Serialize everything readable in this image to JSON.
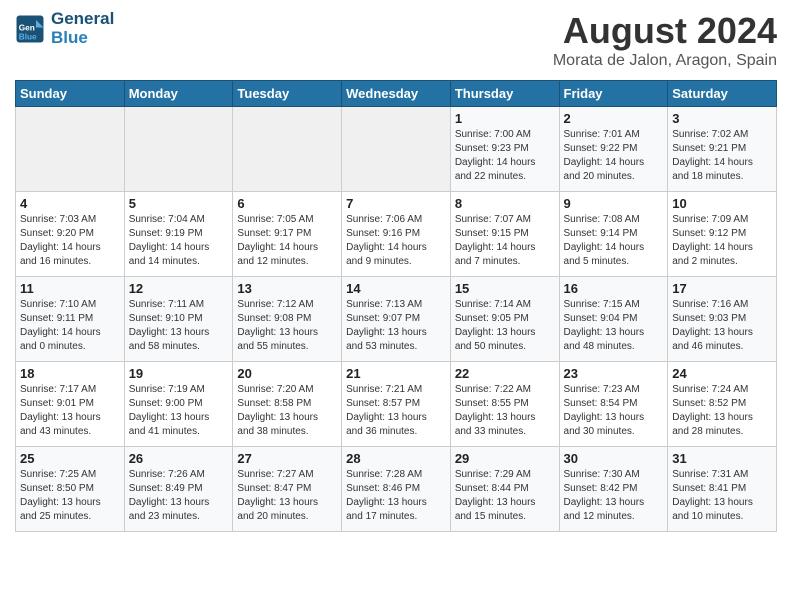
{
  "logo": {
    "line1": "General",
    "line2": "Blue"
  },
  "title": "August 2024",
  "subtitle": "Morata de Jalon, Aragon, Spain",
  "weekdays": [
    "Sunday",
    "Monday",
    "Tuesday",
    "Wednesday",
    "Thursday",
    "Friday",
    "Saturday"
  ],
  "weeks": [
    [
      {
        "day": "",
        "info": ""
      },
      {
        "day": "",
        "info": ""
      },
      {
        "day": "",
        "info": ""
      },
      {
        "day": "",
        "info": ""
      },
      {
        "day": "1",
        "info": "Sunrise: 7:00 AM\nSunset: 9:23 PM\nDaylight: 14 hours\nand 22 minutes."
      },
      {
        "day": "2",
        "info": "Sunrise: 7:01 AM\nSunset: 9:22 PM\nDaylight: 14 hours\nand 20 minutes."
      },
      {
        "day": "3",
        "info": "Sunrise: 7:02 AM\nSunset: 9:21 PM\nDaylight: 14 hours\nand 18 minutes."
      }
    ],
    [
      {
        "day": "4",
        "info": "Sunrise: 7:03 AM\nSunset: 9:20 PM\nDaylight: 14 hours\nand 16 minutes."
      },
      {
        "day": "5",
        "info": "Sunrise: 7:04 AM\nSunset: 9:19 PM\nDaylight: 14 hours\nand 14 minutes."
      },
      {
        "day": "6",
        "info": "Sunrise: 7:05 AM\nSunset: 9:17 PM\nDaylight: 14 hours\nand 12 minutes."
      },
      {
        "day": "7",
        "info": "Sunrise: 7:06 AM\nSunset: 9:16 PM\nDaylight: 14 hours\nand 9 minutes."
      },
      {
        "day": "8",
        "info": "Sunrise: 7:07 AM\nSunset: 9:15 PM\nDaylight: 14 hours\nand 7 minutes."
      },
      {
        "day": "9",
        "info": "Sunrise: 7:08 AM\nSunset: 9:14 PM\nDaylight: 14 hours\nand 5 minutes."
      },
      {
        "day": "10",
        "info": "Sunrise: 7:09 AM\nSunset: 9:12 PM\nDaylight: 14 hours\nand 2 minutes."
      }
    ],
    [
      {
        "day": "11",
        "info": "Sunrise: 7:10 AM\nSunset: 9:11 PM\nDaylight: 14 hours\nand 0 minutes."
      },
      {
        "day": "12",
        "info": "Sunrise: 7:11 AM\nSunset: 9:10 PM\nDaylight: 13 hours\nand 58 minutes."
      },
      {
        "day": "13",
        "info": "Sunrise: 7:12 AM\nSunset: 9:08 PM\nDaylight: 13 hours\nand 55 minutes."
      },
      {
        "day": "14",
        "info": "Sunrise: 7:13 AM\nSunset: 9:07 PM\nDaylight: 13 hours\nand 53 minutes."
      },
      {
        "day": "15",
        "info": "Sunrise: 7:14 AM\nSunset: 9:05 PM\nDaylight: 13 hours\nand 50 minutes."
      },
      {
        "day": "16",
        "info": "Sunrise: 7:15 AM\nSunset: 9:04 PM\nDaylight: 13 hours\nand 48 minutes."
      },
      {
        "day": "17",
        "info": "Sunrise: 7:16 AM\nSunset: 9:03 PM\nDaylight: 13 hours\nand 46 minutes."
      }
    ],
    [
      {
        "day": "18",
        "info": "Sunrise: 7:17 AM\nSunset: 9:01 PM\nDaylight: 13 hours\nand 43 minutes."
      },
      {
        "day": "19",
        "info": "Sunrise: 7:19 AM\nSunset: 9:00 PM\nDaylight: 13 hours\nand 41 minutes."
      },
      {
        "day": "20",
        "info": "Sunrise: 7:20 AM\nSunset: 8:58 PM\nDaylight: 13 hours\nand 38 minutes."
      },
      {
        "day": "21",
        "info": "Sunrise: 7:21 AM\nSunset: 8:57 PM\nDaylight: 13 hours\nand 36 minutes."
      },
      {
        "day": "22",
        "info": "Sunrise: 7:22 AM\nSunset: 8:55 PM\nDaylight: 13 hours\nand 33 minutes."
      },
      {
        "day": "23",
        "info": "Sunrise: 7:23 AM\nSunset: 8:54 PM\nDaylight: 13 hours\nand 30 minutes."
      },
      {
        "day": "24",
        "info": "Sunrise: 7:24 AM\nSunset: 8:52 PM\nDaylight: 13 hours\nand 28 minutes."
      }
    ],
    [
      {
        "day": "25",
        "info": "Sunrise: 7:25 AM\nSunset: 8:50 PM\nDaylight: 13 hours\nand 25 minutes."
      },
      {
        "day": "26",
        "info": "Sunrise: 7:26 AM\nSunset: 8:49 PM\nDaylight: 13 hours\nand 23 minutes."
      },
      {
        "day": "27",
        "info": "Sunrise: 7:27 AM\nSunset: 8:47 PM\nDaylight: 13 hours\nand 20 minutes."
      },
      {
        "day": "28",
        "info": "Sunrise: 7:28 AM\nSunset: 8:46 PM\nDaylight: 13 hours\nand 17 minutes."
      },
      {
        "day": "29",
        "info": "Sunrise: 7:29 AM\nSunset: 8:44 PM\nDaylight: 13 hours\nand 15 minutes."
      },
      {
        "day": "30",
        "info": "Sunrise: 7:30 AM\nSunset: 8:42 PM\nDaylight: 13 hours\nand 12 minutes."
      },
      {
        "day": "31",
        "info": "Sunrise: 7:31 AM\nSunset: 8:41 PM\nDaylight: 13 hours\nand 10 minutes."
      }
    ]
  ]
}
